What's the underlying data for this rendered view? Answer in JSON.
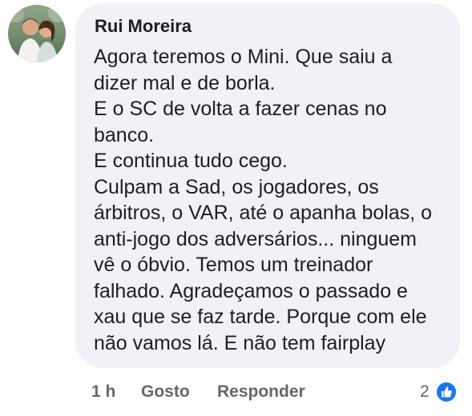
{
  "comment": {
    "author": "Rui Moreira",
    "lines": [
      "Agora teremos o Mini. Que saiu a",
      "dizer mal e de borla.",
      "E o SC de volta a fazer cenas no",
      "banco.",
      "E continua tudo cego.",
      "Culpam a Sad, os jogadores, os",
      "árbitros, o VAR, até o apanha bolas, o",
      "anti-jogo dos adversários... ninguem",
      "vê o óbvio. Temos um treinador",
      "falhado. Agradeçamos o passado e",
      "xau que se faz tarde. Porque com ele",
      "não vamos lá. E não tem fairplay"
    ]
  },
  "actions": {
    "time": "1 h",
    "like_label": "Gosto",
    "reply_label": "Responder",
    "reaction_count": "2"
  },
  "icons": {
    "avatar": "profile-photo",
    "reaction": "thumbs-up-icon"
  },
  "colors": {
    "bubble": "#f0f2f5",
    "text": "#1c1e21",
    "secondary_text": "#65676b",
    "like_blue": "#1877f2"
  }
}
